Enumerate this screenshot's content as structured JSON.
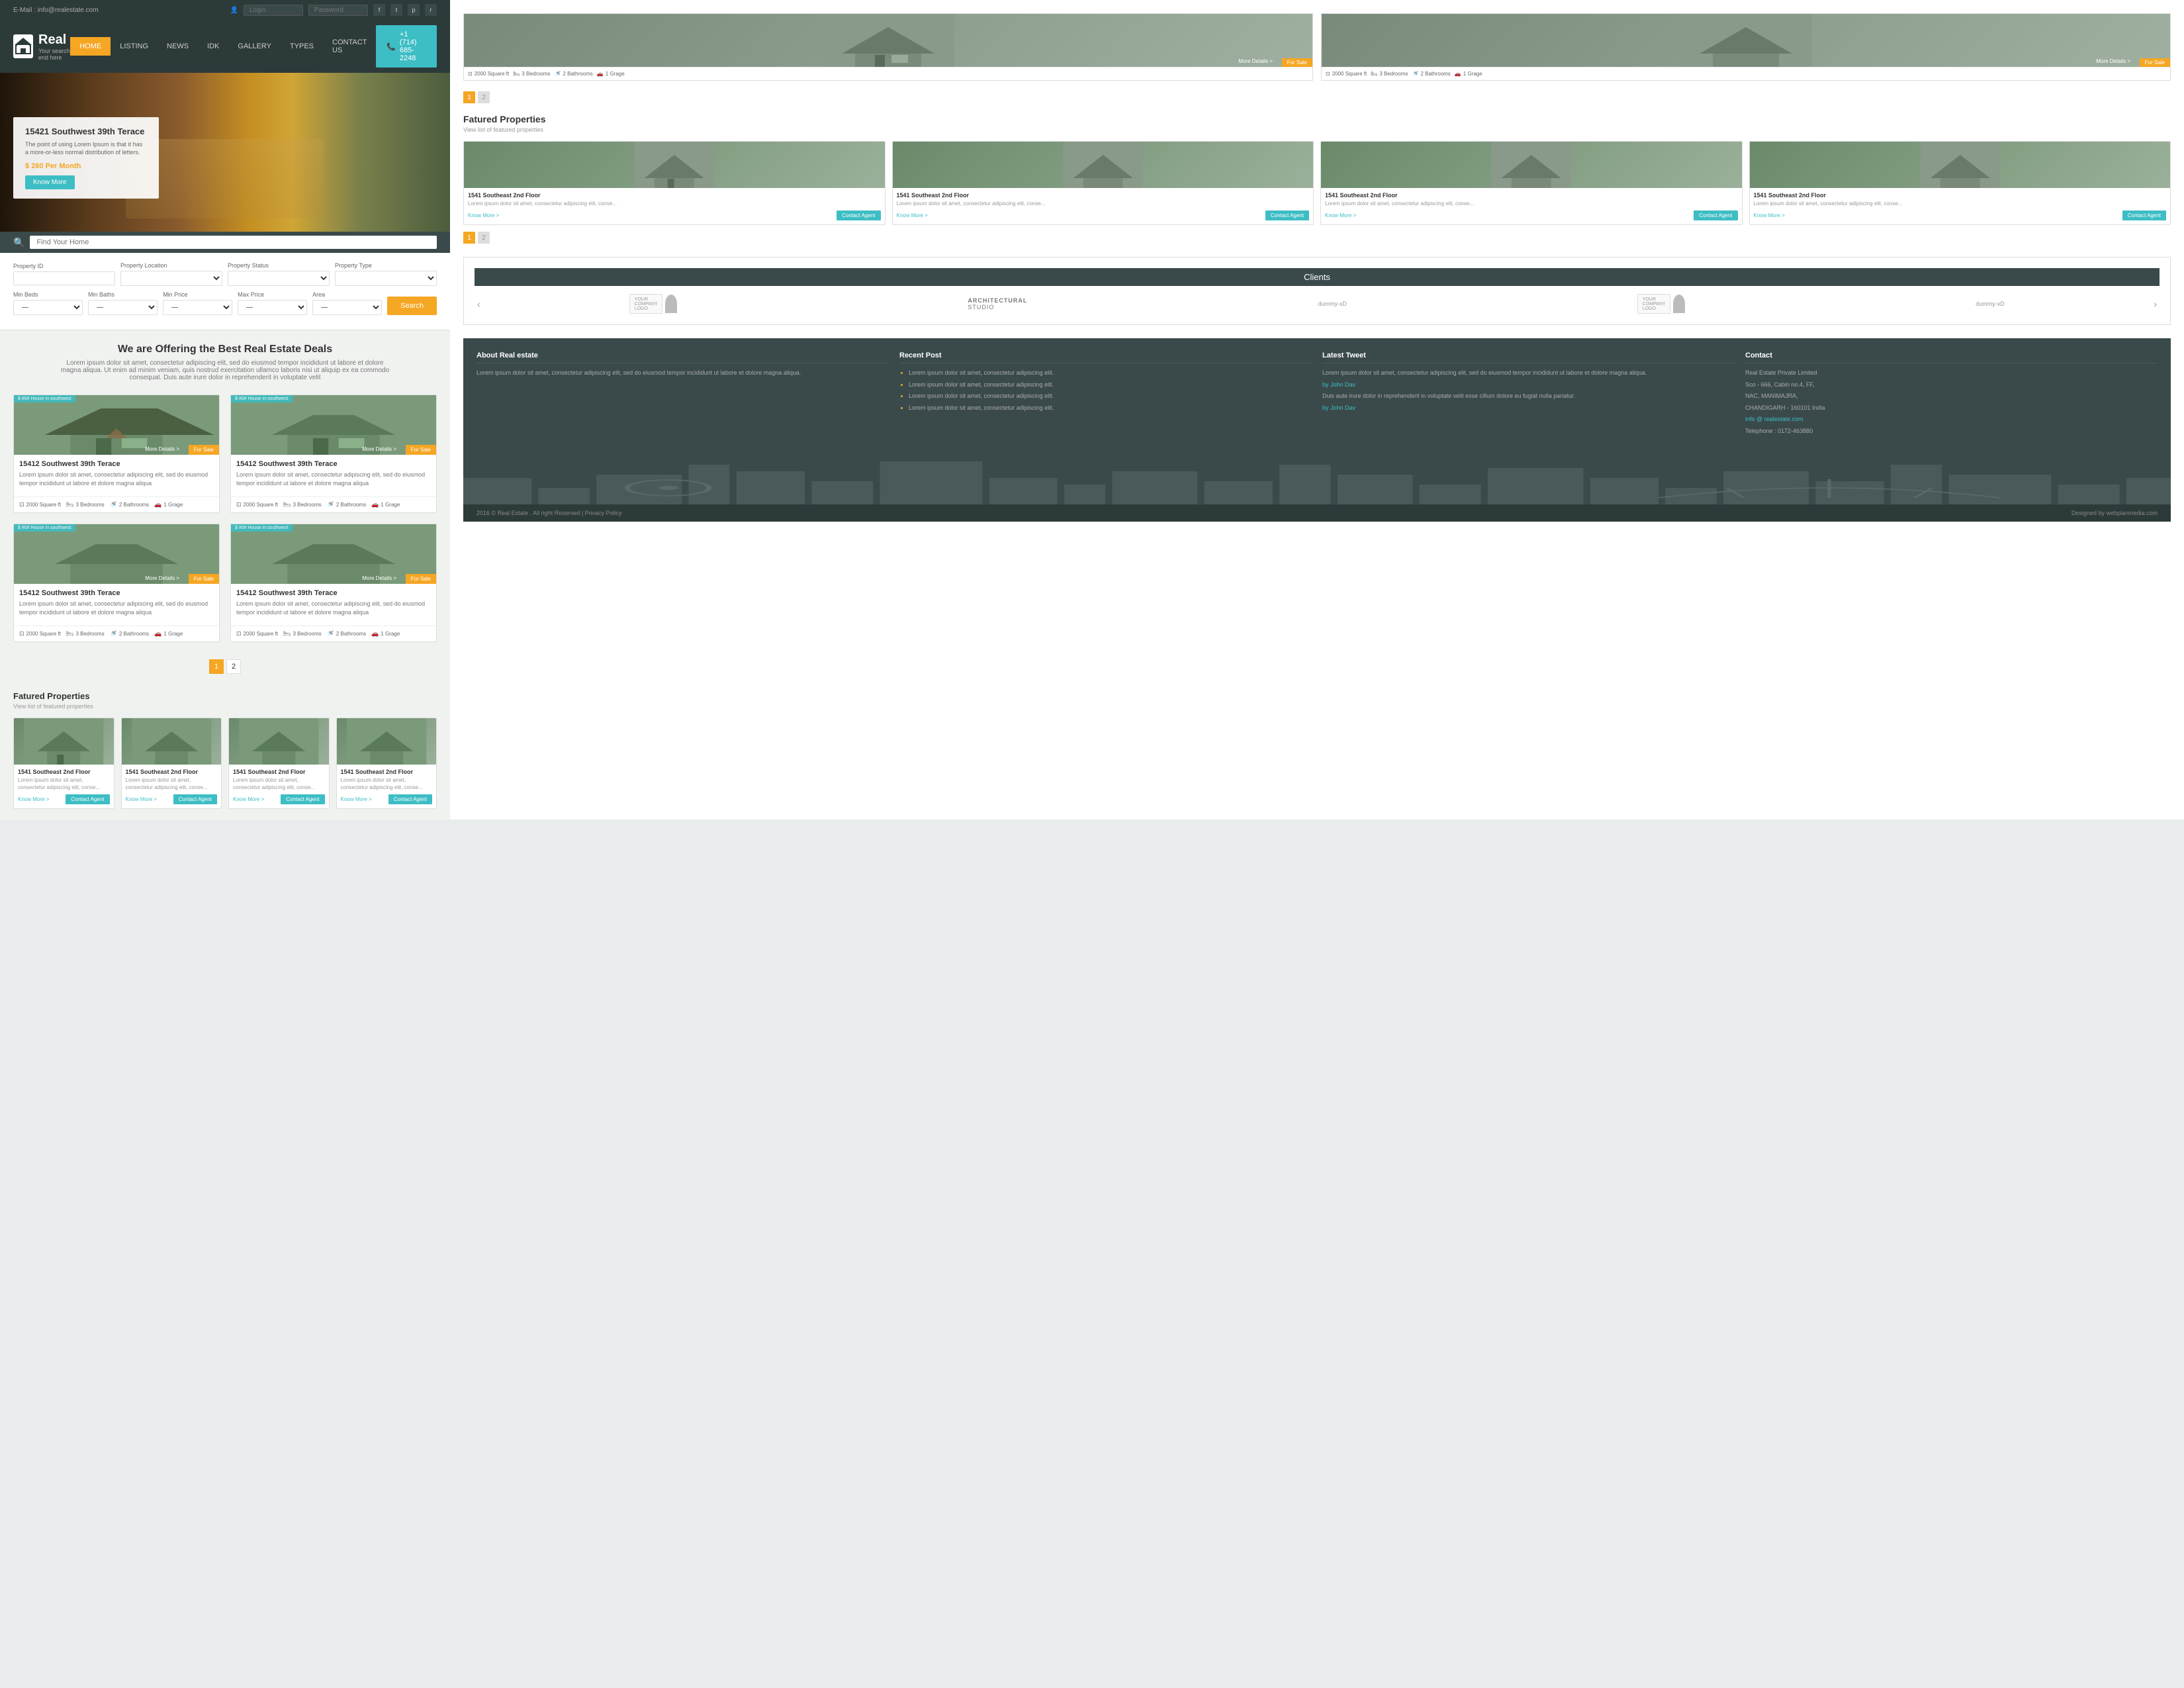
{
  "topbar": {
    "email_label": "E-Mail : info@realestate.com",
    "login_placeholder": "Login",
    "password_placeholder": "Password"
  },
  "header": {
    "logo_letter": "R",
    "logo_brand": "Real",
    "logo_tagline": "Your search end here",
    "nav_items": [
      {
        "label": "HOME",
        "active": true
      },
      {
        "label": "LISTING",
        "active": false
      },
      {
        "label": "NEWS",
        "active": false
      },
      {
        "label": "IDK",
        "active": false
      },
      {
        "label": "GALLERY",
        "active": false
      },
      {
        "label": "TYPES",
        "active": false
      },
      {
        "label": "CONTACT US",
        "active": false
      }
    ],
    "phone": "+1 (714) 685-2248"
  },
  "hero": {
    "property_name": "15421 Southwest 39th Terace",
    "description": "The point of using Lorem Ipsum is that it has a more-or-less normal distribution of letters.",
    "price": "$ 260 Per Month",
    "btn_label": "Know More",
    "search_placeholder": "Find Your Home"
  },
  "search_form": {
    "fields": [
      {
        "label": "Property ID",
        "type": "input",
        "placeholder": ""
      },
      {
        "label": "Property Location",
        "type": "select",
        "placeholder": ""
      },
      {
        "label": "Property Status",
        "type": "select",
        "placeholder": ""
      },
      {
        "label": "Property Type",
        "type": "select",
        "placeholder": ""
      }
    ],
    "fields2": [
      {
        "label": "Min Beds",
        "type": "select",
        "placeholder": "—"
      },
      {
        "label": "Min Baths",
        "type": "select",
        "placeholder": "—"
      },
      {
        "label": "Min Price",
        "type": "select",
        "placeholder": "—"
      },
      {
        "label": "Max Price",
        "type": "select",
        "placeholder": "—"
      },
      {
        "label": "Area",
        "type": "select",
        "placeholder": "—"
      }
    ],
    "search_btn": "Search"
  },
  "best_deals": {
    "title": "We are Offering the Best Real Estate Deals",
    "description": "Lorem ipsum dolor sit amet, consectetur adipiscing elit, sed do eiusmod tempor incididunt ut labore et dolore magna aliqua. Ut enim ad minim veniam, quis nostrud exercitation ullamco laboris nisi ut aliquip ex ea commodo consequat. Duis aute irure dolor in reprehenderit in voluptate velit"
  },
  "properties": [
    {
      "id": 1,
      "title": "15412 Southwest 39th Terace",
      "tag": "$ #0# House in southwest",
      "desc": "Lorem ipsum dolor sit amet, consectetur adipiscing elit, sed do eiusmod tempor incididunt ut labore et dolore magna aliqua",
      "more_details": "More Details >",
      "badge": "For Sale",
      "sqft": "2000 Square ft",
      "bedrooms": "3 Bedrooms",
      "bathrooms": "2 Bathrooms",
      "garage": "1 Grage"
    },
    {
      "id": 2,
      "title": "15412 Southwest 39th Terace",
      "tag": "$ #0# House in southwest",
      "desc": "Lorem ipsum dolor sit amet, consectetur adipiscing elit, sed do eiusmod tempor incididunt ut labore et dolore magna aliqua",
      "more_details": "More Details >",
      "badge": "For Sale",
      "sqft": "2000 Square ft",
      "bedrooms": "3 Bedrooms",
      "bathrooms": "2 Bathrooms",
      "garage": "1 Grage"
    },
    {
      "id": 3,
      "title": "15412 Southwest 39th Terace",
      "tag": "$ #0# House in southwest",
      "desc": "Lorem ipsum dolor sit amet, consectetur adipiscing elit, sed do eiusmod tempor incididunt ut labore et dolore magna aliqua",
      "more_details": "More Details >",
      "badge": "For Sale",
      "sqft": "2000 Square ft",
      "bedrooms": "3 Bedrooms",
      "bathrooms": "2 Bathrooms",
      "garage": "1 Grage"
    },
    {
      "id": 4,
      "title": "15412 Southwest 39th Terace",
      "tag": "$ #0# House in southwest",
      "desc": "Lorem ipsum dolor sit amet, consectetur adipiscing elit, sed do eiusmod tempor incididunt ut labore et dolore magna aliqua",
      "more_details": "More Details >",
      "badge": "For Sale",
      "sqft": "2000 Square ft",
      "bedrooms": "3 Bedrooms",
      "bathrooms": "2 Bathrooms",
      "garage": "1 Grage"
    }
  ],
  "featured_properties": {
    "title": "Fatured Properties",
    "subtitle": "View list of featured properties",
    "items": [
      {
        "title": "1541 Southeast 2nd Floor",
        "desc": "Lorem ipsum dolor sit amet, consectetur adipiscing elit, conse...",
        "link": "Know More >",
        "btn": "Contact Agent"
      },
      {
        "title": "1541 Southeast 2nd Floor",
        "desc": "Lorem ipsum dolor sit amet, consectetur adipiscing elit, conse...",
        "link": "Know More >",
        "btn": "Contact Agent"
      },
      {
        "title": "1541 Southeast 2nd Floor",
        "desc": "Lorem ipsum dolor sit amet, consectetur adipiscing elit, conse...",
        "link": "Know More >",
        "btn": "Contact Agent"
      },
      {
        "title": "1541 Southeast 2nd Floor",
        "desc": "Lorem ipsum dolor sit amet, consectetur adipiscing elit, conse...",
        "link": "Know More >",
        "btn": "Contact Agent"
      }
    ]
  },
  "right_top_cards": [
    {
      "badge": "For Sale",
      "more_details": "More Details >",
      "sqft": "2000 Square ft",
      "bedrooms": "3 Bedrooms",
      "bathrooms": "2 Bathrooms",
      "garage": "1 Grage"
    },
    {
      "badge": "For Sale",
      "more_details": "More Details >",
      "sqft": "2000 Square ft",
      "bedrooms": "3 Bedrooms",
      "bathrooms": "2 Bathrooms",
      "garage": "1 Grage"
    }
  ],
  "clients": {
    "title": "Clients"
  },
  "footer": {
    "about_title": "About Real estate",
    "about_text": "Lorem ipsum dolor sit amet, consectetur adipiscing elit, sed do eiusmod tempor incididunt ut labore et dolore magna aliqua.",
    "recent_post_title": "Recent Post",
    "recent_posts": [
      "Lorem ipsum dolor sit amet, consectetur adipiscing elit.",
      "Lorem ipsum dolor sit amet, consectetur adipiscing elit.",
      "Lorem ipsum dolor sit amet, consectetur adipiscing elit.",
      "Lorem ipsum dolor sit amet, consectetur adipiscing elit."
    ],
    "latest_tweet_title": "Latest Tweet",
    "tweet_text": "Lorem ipsum dolor sit amet, consectetur adipiscing elit, sed do eiusmod tempor incididunt ut labore et dolore magna aliqua.",
    "tweet_author": "by John Dav",
    "tweet_author2": "by John Dav",
    "tweet_text2": "Duis aute irure dolor in reprehenderit in voluptate velit esse cillum dolore eu fugiat nulla pariatur.",
    "contact_title": "Contact",
    "contact_company": "Real Estate Private Limited",
    "contact_addr1": "Sco - 666, Cabin no.4, FF,",
    "contact_addr2": "NAC, MANIMAJRA,",
    "contact_addr3": "CHANDIGARH - 160101 India",
    "contact_email": "info @ realestate.com",
    "contact_phone": "Telephone : 0172-463880",
    "copyright": "2016 © Real Estate . All right Reserved | Privacy Policy",
    "designed": "Designed by webplanmedia.com"
  }
}
